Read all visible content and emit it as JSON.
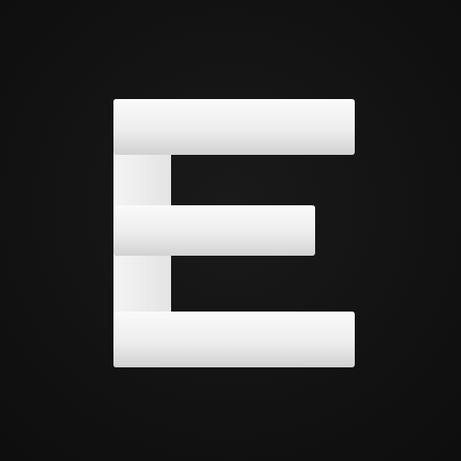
{
  "logo": {
    "letter": "E",
    "icon": "letter-e-logo-icon",
    "background_color": "#121212",
    "letter_color": "#f2f2f2",
    "letter_shadow_color": "#c9c9c9"
  }
}
